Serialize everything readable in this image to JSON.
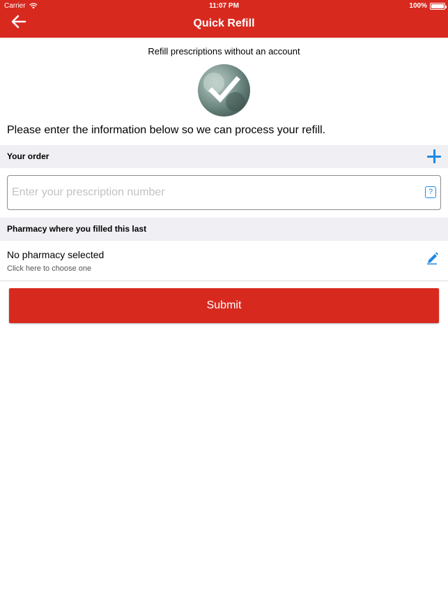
{
  "status_bar": {
    "carrier": "Carrier",
    "time": "11:07 PM",
    "battery": "100%"
  },
  "nav": {
    "title": "Quick Refill",
    "back_icon": "arrow-left-icon"
  },
  "subtitle": "Refill prescriptions without an account",
  "intro": "Please enter the information below so we can process your refill.",
  "order": {
    "header": "Your order",
    "add_icon": "plus-icon",
    "input_placeholder": "Enter your prescription number",
    "input_value": "",
    "help_label": "?"
  },
  "pharmacy": {
    "header": "Pharmacy where you filled this last",
    "selected": "No pharmacy selected",
    "hint": "Click here to choose one",
    "edit_icon": "pencil-icon"
  },
  "submit_label": "Submit",
  "colors": {
    "brand_red": "#d8291f",
    "accent_blue": "#1e88e5",
    "section_bg": "#efeff4"
  }
}
